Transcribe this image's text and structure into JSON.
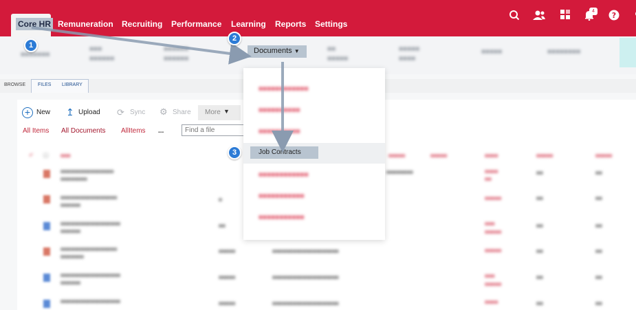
{
  "nav": {
    "items": [
      "Core HR",
      "Remuneration",
      "Recruiting",
      "Performance",
      "Learning",
      "Reports",
      "Settings"
    ],
    "notification_count": "4"
  },
  "subnav": {
    "documents_label": "Documents"
  },
  "ribbon": {
    "browse": "BROWSE",
    "files": "FILES",
    "library": "LIBRARY"
  },
  "toolbar": {
    "new": "New",
    "upload": "Upload",
    "sync": "Sync",
    "share": "Share",
    "more": "More"
  },
  "views": {
    "all_items": "All Items",
    "all_documents": "All Documents",
    "allitems": "AllItems",
    "more": "...",
    "find_placeholder": "Find a file"
  },
  "dropdown": {
    "selected": "Job Contracts"
  },
  "steps": [
    "1",
    "2",
    "3"
  ],
  "colors": {
    "brand_red": "#d31a3b",
    "highlight": "#b8c4d0",
    "step_blue": "#2c7bd6"
  }
}
